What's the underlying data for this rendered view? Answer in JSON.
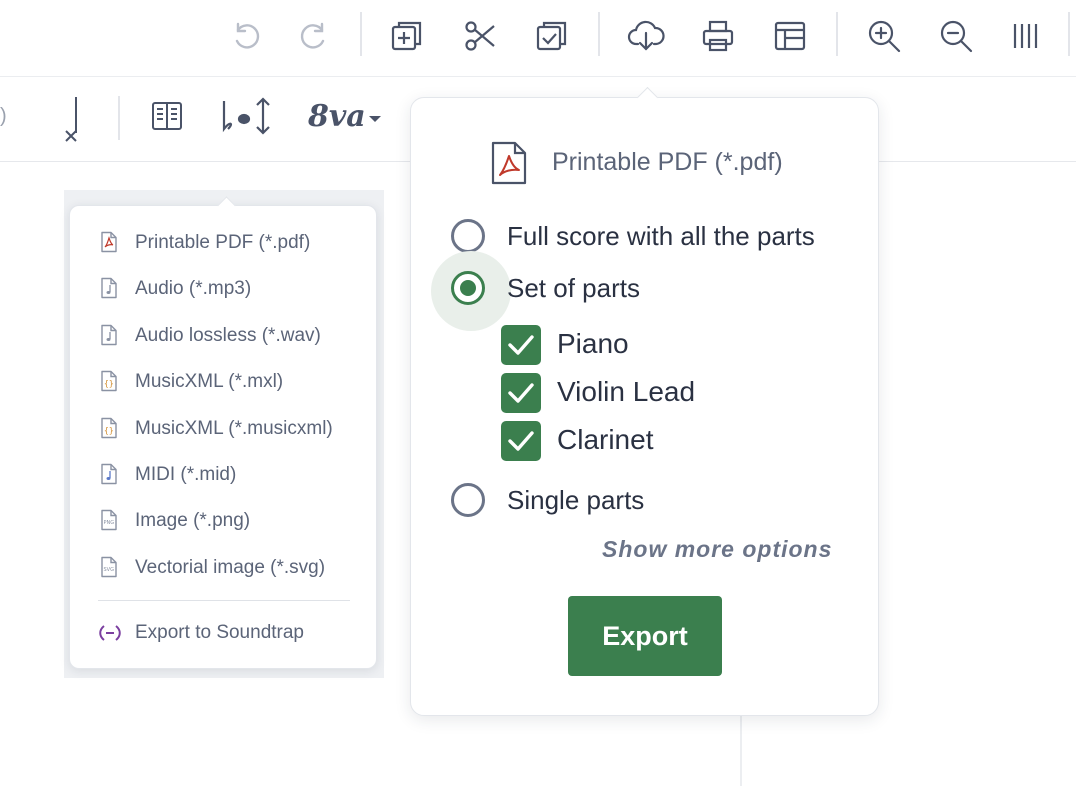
{
  "toolbar": {
    "icons": [
      "undo-icon",
      "redo-icon",
      "duplicate-icon",
      "cut-icon",
      "paste-icon",
      "download-icon",
      "print-icon",
      "layout-icon",
      "zoom-in-icon",
      "zoom-out-icon",
      "barlines-icon"
    ]
  },
  "secondary_toolbar": {
    "ottava_label": "8va"
  },
  "export_menu": {
    "items": [
      {
        "label": "Printable PDF (*.pdf)",
        "icon": "pdf-file-icon"
      },
      {
        "label": "Audio (*.mp3)",
        "icon": "audio-file-icon"
      },
      {
        "label": "Audio lossless (*.wav)",
        "icon": "audio-file-icon"
      },
      {
        "label": "MusicXML (*.mxl)",
        "icon": "musicxml-file-icon"
      },
      {
        "label": "MusicXML (*.musicxml)",
        "icon": "musicxml-file-icon"
      },
      {
        "label": "MIDI (*.mid)",
        "icon": "midi-file-icon"
      },
      {
        "label": "Image (*.png)",
        "icon": "png-file-icon"
      },
      {
        "label": "Vectorial image (*.svg)",
        "icon": "svg-file-icon"
      }
    ],
    "soundtrap": {
      "label": "Export to Soundtrap",
      "icon": "soundtrap-icon"
    }
  },
  "export_panel": {
    "title": "Printable PDF (*.pdf)",
    "options": [
      {
        "label": "Full score with all the parts",
        "selected": false
      },
      {
        "label": "Set of parts",
        "selected": true
      },
      {
        "label": "Single parts",
        "selected": false
      }
    ],
    "parts": [
      {
        "label": "Piano",
        "checked": true
      },
      {
        "label": "Violin Lead",
        "checked": true
      },
      {
        "label": "Clarinet",
        "checked": true
      }
    ],
    "more_options": "Show more options",
    "export_label": "Export"
  },
  "colors": {
    "accent_green": "#3b7f4e",
    "text_dark": "#2a3142",
    "text_muted": "#5b6478",
    "pdf_red": "#c0392b"
  }
}
